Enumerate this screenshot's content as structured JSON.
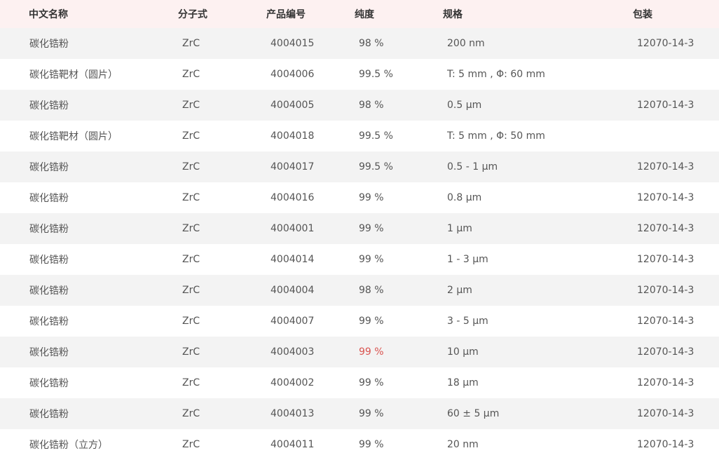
{
  "table": {
    "headers": {
      "name": "中文名称",
      "formula": "分子式",
      "code": "产品编号",
      "purity": "纯度",
      "spec": "规格",
      "pack": "包装"
    },
    "rows": [
      {
        "name": "碳化锆粉",
        "formula": "ZrC",
        "code": "4004015",
        "purity": "98 %",
        "spec": "200 nm",
        "pack": "12070-14-3"
      },
      {
        "name": "碳化锆靶材（圆片）",
        "formula": "ZrC",
        "code": "4004006",
        "purity": "99.5 %",
        "spec": "T: 5 mm , Φ: 60 mm",
        "pack": ""
      },
      {
        "name": "碳化锆粉",
        "formula": "ZrC",
        "code": "4004005",
        "purity": "98 %",
        "spec": "0.5 μm",
        "pack": "12070-14-3"
      },
      {
        "name": "碳化锆靶材（圆片）",
        "formula": "ZrC",
        "code": "4004018",
        "purity": "99.5 %",
        "spec": "T: 5 mm , Φ: 50 mm",
        "pack": ""
      },
      {
        "name": "碳化锆粉",
        "formula": "ZrC",
        "code": "4004017",
        "purity": "99.5 %",
        "spec": "0.5 - 1 μm",
        "pack": "12070-14-3"
      },
      {
        "name": "碳化锆粉",
        "formula": "ZrC",
        "code": "4004016",
        "purity": "99 %",
        "spec": "0.8 μm",
        "pack": "12070-14-3"
      },
      {
        "name": "碳化锆粉",
        "formula": "ZrC",
        "code": "4004001",
        "purity": "99 %",
        "spec": "1 μm",
        "pack": "12070-14-3"
      },
      {
        "name": "碳化锆粉",
        "formula": "ZrC",
        "code": "4004014",
        "purity": "99 %",
        "spec": "1 - 3 μm",
        "pack": "12070-14-3"
      },
      {
        "name": "碳化锆粉",
        "formula": "ZrC",
        "code": "4004004",
        "purity": "98 %",
        "spec": "2 μm",
        "pack": "12070-14-3"
      },
      {
        "name": "碳化锆粉",
        "formula": "ZrC",
        "code": "4004007",
        "purity": "99 %",
        "spec": "3 - 5 μm",
        "pack": "12070-14-3"
      },
      {
        "name": "碳化锆粉",
        "formula": "ZrC",
        "code": "4004003",
        "purity": "99 %",
        "spec": "10 μm",
        "pack": "12070-14-3"
      },
      {
        "name": "碳化锆粉",
        "formula": "ZrC",
        "code": "4004002",
        "purity": "99 %",
        "spec": "18 μm",
        "pack": "12070-14-3"
      },
      {
        "name": "碳化锆粉",
        "formula": "ZrC",
        "code": "4004013",
        "purity": "99 %",
        "spec": "60 ± 5 μm",
        "pack": "12070-14-3"
      },
      {
        "name": "碳化锆粉（立方）",
        "formula": "ZrC",
        "code": "4004011",
        "purity": "99 %",
        "spec": "20 nm",
        "pack": "12070-14-3"
      }
    ],
    "highlight_color": "#d9534f",
    "header_bg": "#fdf1f1",
    "stripe_bg": "#f3f3f3"
  }
}
